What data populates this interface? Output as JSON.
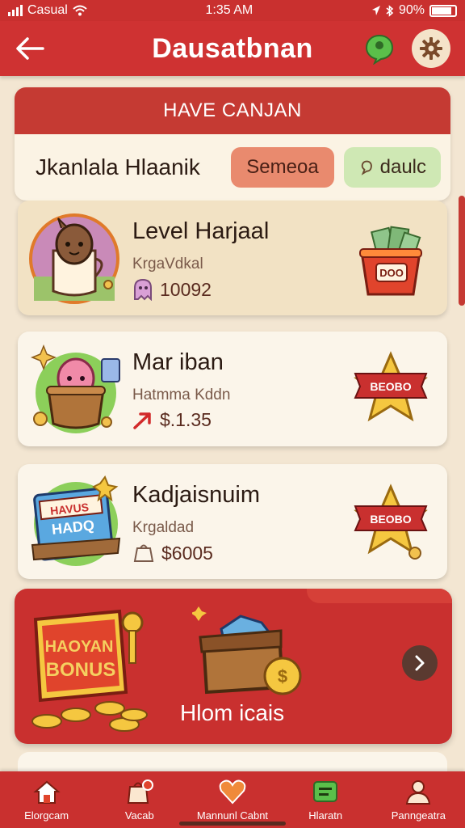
{
  "status_bar": {
    "carrier": "Casual",
    "time": "1:35 AM",
    "battery": "90%"
  },
  "header": {
    "title": "Dausatbnan"
  },
  "panel": {
    "heading": "HAVE CANJAN",
    "name": "Jkanlala Hlaanik",
    "button_orange": "Semeoa",
    "button_green": "daulc"
  },
  "cards": [
    {
      "title": "Level Harjaal",
      "subtitle": "KrgaVdkal",
      "value": "10092",
      "reward_label": "DOO"
    },
    {
      "title": "Mar iban",
      "subtitle": "Hatmma Kddn",
      "value": "$.1.35",
      "reward_label": "BEOBO"
    },
    {
      "title": "Kadjaisnuim",
      "subtitle": "Krgaldad",
      "value": "$6005",
      "reward_label": "BEOBO",
      "art_label_1": "HAVUS",
      "art_label_2": "HADQ"
    }
  ],
  "promo": {
    "badge_line1": "HAOYAN",
    "badge_line2": "BONUS",
    "label": "Hlom icais"
  },
  "bottom_nav": [
    {
      "label": "Elorgcam"
    },
    {
      "label": "Vacab"
    },
    {
      "label": "Mannunl Cabnt"
    },
    {
      "label": "Hlaratn"
    },
    {
      "label": "Panngeatra"
    }
  ],
  "colors": {
    "primary_red": "#c9302f",
    "panel_bg": "#fbf3e4",
    "orange_pill": "#e98a6e",
    "green_pill": "#cfe8b4",
    "gold": "#f2c14e"
  }
}
